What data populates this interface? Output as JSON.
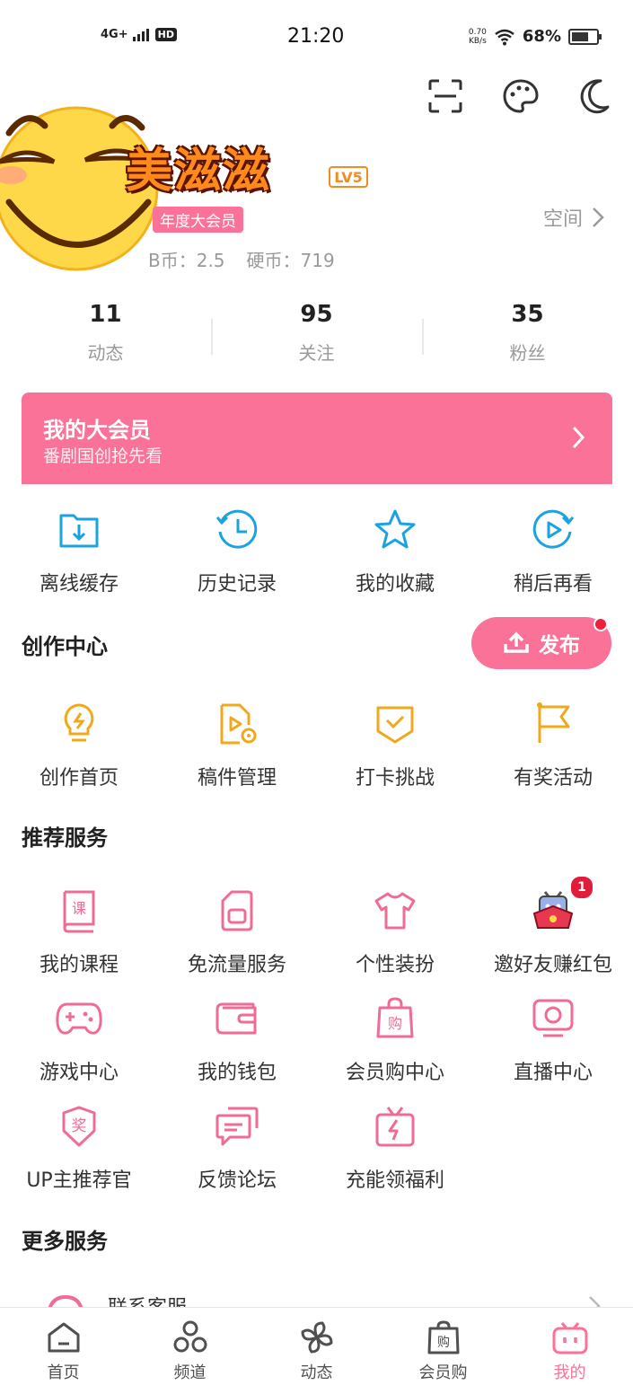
{
  "status_bar": {
    "network": "4G+",
    "hd": "HD",
    "time": "21:20",
    "speed_value": "0.70",
    "speed_unit": "KB/s",
    "battery": "68%",
    "battery_level": 0.68
  },
  "profile": {
    "username": "美滋滋",
    "level": "LV5",
    "vip_badge": "年度大会员",
    "space_link": "空间",
    "b_coins": "B币：2.5",
    "coins": "硬币：719"
  },
  "stats": [
    {
      "num": "11",
      "label": "动态"
    },
    {
      "num": "95",
      "label": "关注"
    },
    {
      "num": "35",
      "label": "粉丝"
    }
  ],
  "vip_banner": {
    "title": "我的大会员",
    "subtitle": "番剧国创抢先看"
  },
  "quick_actions": [
    {
      "label": "离线缓存",
      "icon": "download-folder-icon"
    },
    {
      "label": "历史记录",
      "icon": "history-clock-icon"
    },
    {
      "label": "我的收藏",
      "icon": "star-icon"
    },
    {
      "label": "稍后再看",
      "icon": "watch-later-icon"
    }
  ],
  "creation_center": {
    "title": "创作中心",
    "publish_label": "发布",
    "items": [
      {
        "label": "创作首页",
        "icon": "lightbulb-icon"
      },
      {
        "label": "稿件管理",
        "icon": "manuscript-icon"
      },
      {
        "label": "打卡挑战",
        "icon": "checkin-shield-icon"
      },
      {
        "label": "有奖活动",
        "icon": "flag-icon"
      }
    ]
  },
  "recommended_services": {
    "title": "推荐服务",
    "rows": [
      [
        {
          "label": "我的课程",
          "icon": "course-book-icon"
        },
        {
          "label": "免流量服务",
          "icon": "sim-card-icon"
        },
        {
          "label": "个性装扮",
          "icon": "tshirt-icon"
        },
        {
          "label": "邀好友赚红包",
          "icon": "tv-mascot-envelope-icon",
          "badge": "1"
        }
      ],
      [
        {
          "label": "游戏中心",
          "icon": "gamepad-icon"
        },
        {
          "label": "我的钱包",
          "icon": "wallet-icon"
        },
        {
          "label": "会员购中心",
          "icon": "shopping-bag-icon"
        },
        {
          "label": "直播中心",
          "icon": "live-tv-icon"
        }
      ],
      [
        {
          "label": "UP主推荐官",
          "icon": "award-shield-icon"
        },
        {
          "label": "反馈论坛",
          "icon": "chat-bubble-icon"
        },
        {
          "label": "充能领福利",
          "icon": "gift-charge-icon"
        }
      ]
    ]
  },
  "more_services": {
    "title": "更多服务",
    "first_item": "联系客服"
  },
  "tab_bar": [
    {
      "label": "首页",
      "icon": "home-icon"
    },
    {
      "label": "频道",
      "icon": "channel-icon"
    },
    {
      "label": "动态",
      "icon": "pinwheel-icon"
    },
    {
      "label": "会员购",
      "icon": "shopping-bag-icon"
    },
    {
      "label": "我的",
      "icon": "tv-icon",
      "active": true
    }
  ],
  "colors": {
    "accent": "#fb7299",
    "blue_icons": "#1aa3e0",
    "gold_icons": "#f0a81c",
    "pink_icons": "#f06c95"
  }
}
